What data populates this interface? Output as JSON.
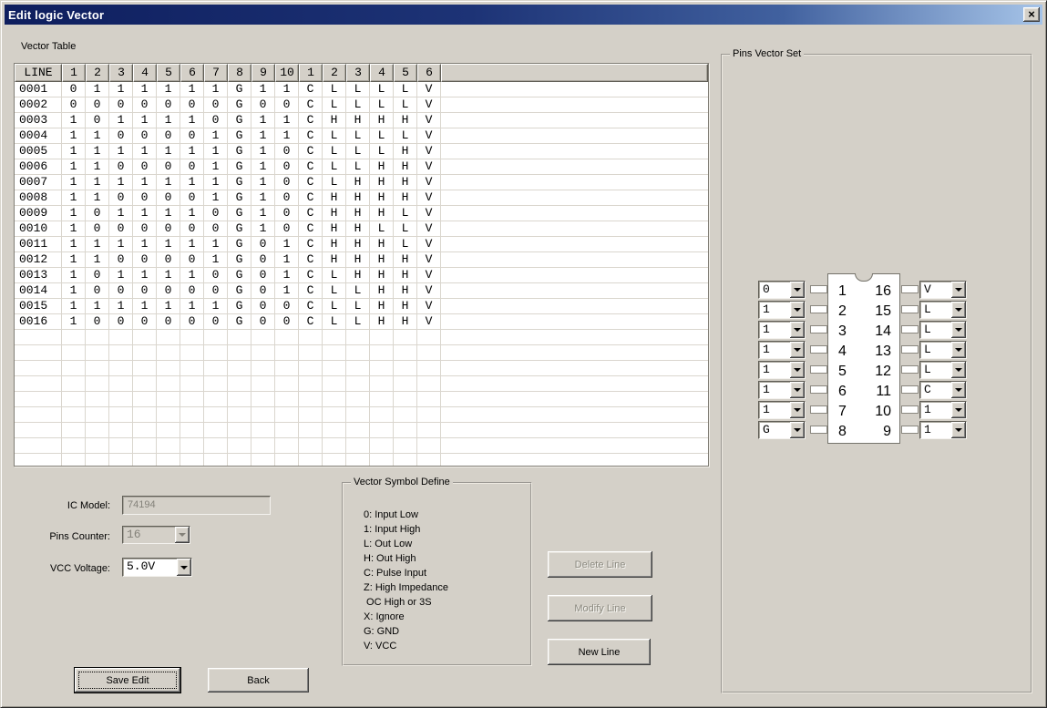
{
  "window": {
    "title": "Edit logic Vector",
    "close_glyph": "×"
  },
  "vector_table": {
    "label": "Vector Table",
    "header": [
      "LINE",
      "1",
      "2",
      "3",
      "4",
      "5",
      "6",
      "7",
      "8",
      "9",
      "10",
      "1",
      "2",
      "3",
      "4",
      "5",
      "6"
    ],
    "rows": [
      {
        "line": "0001",
        "cells": [
          "0",
          "1",
          "1",
          "1",
          "1",
          "1",
          "1",
          "G",
          "1",
          "1",
          "C",
          "L",
          "L",
          "L",
          "L",
          "V"
        ]
      },
      {
        "line": "0002",
        "cells": [
          "0",
          "0",
          "0",
          "0",
          "0",
          "0",
          "0",
          "G",
          "0",
          "0",
          "C",
          "L",
          "L",
          "L",
          "L",
          "V"
        ]
      },
      {
        "line": "0003",
        "cells": [
          "1",
          "0",
          "1",
          "1",
          "1",
          "1",
          "0",
          "G",
          "1",
          "1",
          "C",
          "H",
          "H",
          "H",
          "H",
          "V"
        ]
      },
      {
        "line": "0004",
        "cells": [
          "1",
          "1",
          "0",
          "0",
          "0",
          "0",
          "1",
          "G",
          "1",
          "1",
          "C",
          "L",
          "L",
          "L",
          "L",
          "V"
        ]
      },
      {
        "line": "0005",
        "cells": [
          "1",
          "1",
          "1",
          "1",
          "1",
          "1",
          "1",
          "G",
          "1",
          "0",
          "C",
          "L",
          "L",
          "L",
          "H",
          "V"
        ]
      },
      {
        "line": "0006",
        "cells": [
          "1",
          "1",
          "0",
          "0",
          "0",
          "0",
          "1",
          "G",
          "1",
          "0",
          "C",
          "L",
          "L",
          "H",
          "H",
          "V"
        ]
      },
      {
        "line": "0007",
        "cells": [
          "1",
          "1",
          "1",
          "1",
          "1",
          "1",
          "1",
          "G",
          "1",
          "0",
          "C",
          "L",
          "H",
          "H",
          "H",
          "V"
        ]
      },
      {
        "line": "0008",
        "cells": [
          "1",
          "1",
          "0",
          "0",
          "0",
          "0",
          "1",
          "G",
          "1",
          "0",
          "C",
          "H",
          "H",
          "H",
          "H",
          "V"
        ]
      },
      {
        "line": "0009",
        "cells": [
          "1",
          "0",
          "1",
          "1",
          "1",
          "1",
          "0",
          "G",
          "1",
          "0",
          "C",
          "H",
          "H",
          "H",
          "L",
          "V"
        ]
      },
      {
        "line": "0010",
        "cells": [
          "1",
          "0",
          "0",
          "0",
          "0",
          "0",
          "0",
          "G",
          "1",
          "0",
          "C",
          "H",
          "H",
          "L",
          "L",
          "V"
        ]
      },
      {
        "line": "0011",
        "cells": [
          "1",
          "1",
          "1",
          "1",
          "1",
          "1",
          "1",
          "G",
          "0",
          "1",
          "C",
          "H",
          "H",
          "H",
          "L",
          "V"
        ]
      },
      {
        "line": "0012",
        "cells": [
          "1",
          "1",
          "0",
          "0",
          "0",
          "0",
          "1",
          "G",
          "0",
          "1",
          "C",
          "H",
          "H",
          "H",
          "H",
          "V"
        ]
      },
      {
        "line": "0013",
        "cells": [
          "1",
          "0",
          "1",
          "1",
          "1",
          "1",
          "0",
          "G",
          "0",
          "1",
          "C",
          "L",
          "H",
          "H",
          "H",
          "V"
        ]
      },
      {
        "line": "0014",
        "cells": [
          "1",
          "0",
          "0",
          "0",
          "0",
          "0",
          "0",
          "G",
          "0",
          "1",
          "C",
          "L",
          "L",
          "H",
          "H",
          "V"
        ]
      },
      {
        "line": "0015",
        "cells": [
          "1",
          "1",
          "1",
          "1",
          "1",
          "1",
          "1",
          "G",
          "0",
          "0",
          "C",
          "L",
          "L",
          "H",
          "H",
          "V"
        ]
      },
      {
        "line": "0016",
        "cells": [
          "1",
          "0",
          "0",
          "0",
          "0",
          "0",
          "0",
          "G",
          "0",
          "0",
          "C",
          "L",
          "L",
          "H",
          "H",
          "V"
        ]
      }
    ],
    "empty_row_count": 10
  },
  "pins_vector_set": {
    "label": "Pins Vector Set",
    "left_pins": [
      {
        "pin": "1",
        "value": "0"
      },
      {
        "pin": "2",
        "value": "1"
      },
      {
        "pin": "3",
        "value": "1"
      },
      {
        "pin": "4",
        "value": "1"
      },
      {
        "pin": "5",
        "value": "1"
      },
      {
        "pin": "6",
        "value": "1"
      },
      {
        "pin": "7",
        "value": "1"
      },
      {
        "pin": "8",
        "value": "G"
      }
    ],
    "right_pins": [
      {
        "pin": "16",
        "value": "V"
      },
      {
        "pin": "15",
        "value": "L"
      },
      {
        "pin": "14",
        "value": "L"
      },
      {
        "pin": "13",
        "value": "L"
      },
      {
        "pin": "12",
        "value": "L"
      },
      {
        "pin": "11",
        "value": "C"
      },
      {
        "pin": "10",
        "value": "1"
      },
      {
        "pin": "9",
        "value": "1"
      }
    ]
  },
  "form": {
    "ic_model_label": "IC Model:",
    "ic_model_value": "74194",
    "pins_counter_label": "Pins Counter:",
    "pins_counter_value": "16",
    "vcc_voltage_label": "VCC Voltage:",
    "vcc_voltage_value": "5.0V"
  },
  "symbol_define": {
    "label": "Vector Symbol Define",
    "lines": [
      "0: Input Low",
      "1: Input High",
      "L: Out Low",
      "H: Out High",
      "C: Pulse Input",
      "Z: High Impedance",
      " OC High or 3S",
      "X: Ignore",
      "G: GND",
      "V: VCC"
    ]
  },
  "buttons": {
    "delete_line": "Delete Line",
    "modify_line": "Modify Line",
    "new_line": "New Line",
    "save_edit": "Save Edit",
    "back": "Back"
  },
  "colors": {
    "dialog_bg": "#d4d0c8",
    "titlebar_start": "#0e1e5e",
    "titlebar_end": "#a6c4e8",
    "grid_line": "#dad6ce",
    "disabled_text": "#84827a"
  }
}
